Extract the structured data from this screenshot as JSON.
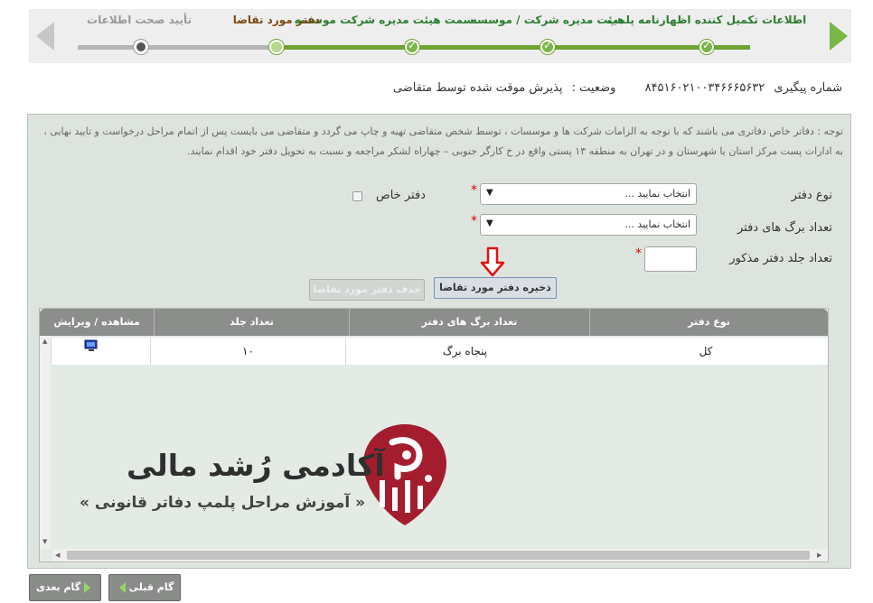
{
  "wizard": {
    "steps": [
      {
        "label": "اطلاعات تکمیل کننده اظهارنامه پلمپ",
        "state": "done"
      },
      {
        "label": "هیئت مدیره شرکت / موسسه",
        "state": "done"
      },
      {
        "label": "سمت هیئت مدیره شرکت موسسه",
        "state": "done"
      },
      {
        "label": "دفتر مورد تقاضا",
        "state": "current"
      },
      {
        "label": "تأیید صحت اطلاعات",
        "state": "todo"
      }
    ]
  },
  "tracking": {
    "label": "شماره پیگیری",
    "number": "۸۴۵۱۶۰۲۱۰۰۳۴۶۶۶۵۶۳۲",
    "status_label": "وضعیت :",
    "status_value": "پذیرش موقت شده توسط متقاضی"
  },
  "notice": "توجه : دفاتر خاص دفاتری می باشند که با توجه به الزامات شرکت ها و موسسات ، توسط شخص متقاضی تهیه و چاپ می گردد و متقاضی می بایست پس از اتمام مراحل درخواست و تایید نهایی ، به ادارات پست مرکز استان یا شهرستان و در تهران به منطقه ۱۳ پستی واقع در خ کارگر جنوبی – چهاراه لشکر مراجعه و نسبت به تحویل دفتر خود اقدام نمایند.",
  "form": {
    "book_type_label": "نوع دفتر",
    "book_type_value": "انتخاب نمایید ...",
    "special_book_label": "دفتر خاص",
    "pages_label": "تعداد برگ های دفتر",
    "pages_value": "انتخاب نمایید ...",
    "volumes_label": "تعداد جلد دفتر مذکور",
    "required_mark": "*",
    "save_button": "ذخیره دفتر مورد تقاضا",
    "delete_button": "حذف دفتر مورد تقاضا"
  },
  "grid": {
    "columns": [
      "نوع دفتر",
      "تعداد برگ های دفتر",
      "تعداد جلد",
      "مشاهده / ویرایش"
    ],
    "rows": [
      {
        "type": "کل",
        "pages": "پنجاه برگ",
        "volumes": "۱۰"
      }
    ]
  },
  "watermark": {
    "title": "آکادمی رُشد مالی",
    "subtitle": "« آموزش مراحل پلمپ دفاتر قانونی »"
  },
  "footer": {
    "prev_button": "گام قبلی",
    "next_button": "گام بعدی"
  },
  "colors": {
    "accent_green": "#7ab648",
    "logo_red": "#a41d2f"
  }
}
